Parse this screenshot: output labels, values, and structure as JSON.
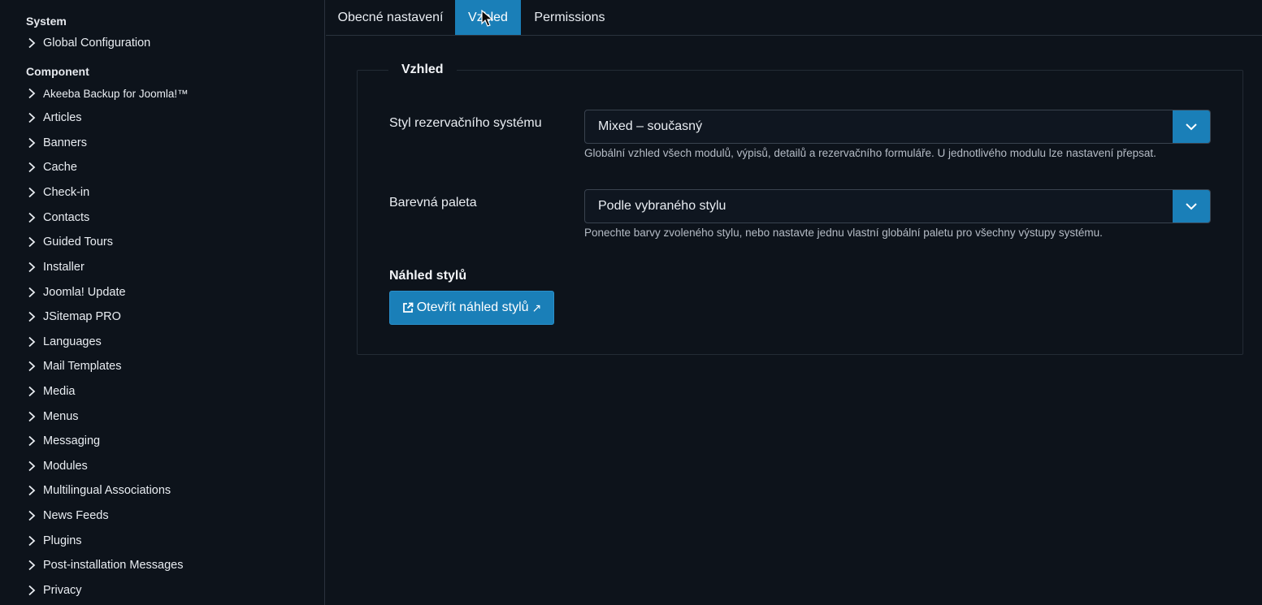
{
  "sidebar": {
    "sections": [
      {
        "title": "System"
      },
      {
        "title": "Component"
      }
    ],
    "system_items": [
      {
        "label": "Global Configuration"
      }
    ],
    "component_items": [
      {
        "label": "Akeeba Backup for Joomla!™"
      },
      {
        "label": "Articles"
      },
      {
        "label": "Banners"
      },
      {
        "label": "Cache"
      },
      {
        "label": "Check-in"
      },
      {
        "label": "Contacts"
      },
      {
        "label": "Guided Tours"
      },
      {
        "label": "Installer"
      },
      {
        "label": "Joomla! Update"
      },
      {
        "label": "JSitemap PRO"
      },
      {
        "label": "Languages"
      },
      {
        "label": "Mail Templates"
      },
      {
        "label": "Media"
      },
      {
        "label": "Menus"
      },
      {
        "label": "Messaging"
      },
      {
        "label": "Modules"
      },
      {
        "label": "Multilingual Associations"
      },
      {
        "label": "News Feeds"
      },
      {
        "label": "Plugins"
      },
      {
        "label": "Post-installation Messages"
      },
      {
        "label": "Privacy"
      }
    ],
    "chevron_icon": "chevron-right-icon"
  },
  "tabs": [
    {
      "label": "Obecné nastavení",
      "active": false
    },
    {
      "label": "Vzhled",
      "active": true
    },
    {
      "label": "Permissions",
      "active": false
    }
  ],
  "fieldset": {
    "legend": "Vzhled",
    "fields": [
      {
        "label": "Styl rezervačního systému",
        "value": "Mixed – současný",
        "help": "Globální vzhled všech modulů, výpisů, detailů a rezervačního formuláře. U jednotlivého modulu lze nastavení přepsat."
      },
      {
        "label": "Barevná paleta",
        "value": "Podle vybraného stylu",
        "help": "Ponechte barvy zvoleného stylu, nebo nastavte jednu vlastní globální paletu pro všechny výstupy systému."
      }
    ],
    "preview_title": "Náhled stylů",
    "preview_button": "Otevřít náhled stylů",
    "preview_button_arrow": "↗"
  },
  "colors": {
    "accent": "#1a7fb8",
    "background": "#0d131b",
    "border": "#2a323d"
  }
}
